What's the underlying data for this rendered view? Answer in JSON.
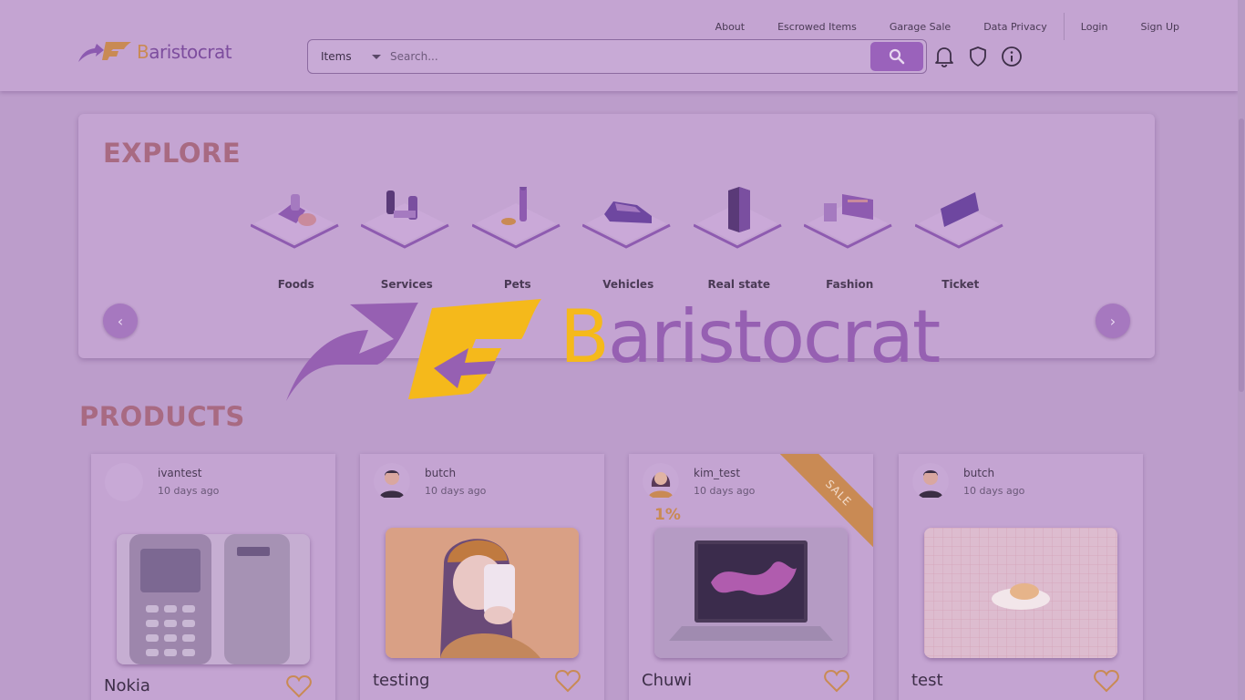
{
  "header": {
    "brand": "Baristocrat",
    "brand_first_letter": "B",
    "brand_rest": "aristocrat",
    "links": [
      "About",
      "Escrowed Items",
      "Garage Sale",
      "Data Privacy",
      "Login",
      "Sign Up"
    ],
    "search": {
      "category": "Items",
      "placeholder": "Search..."
    },
    "icons": [
      "bell-icon",
      "shield-icon",
      "info-icon"
    ]
  },
  "explore": {
    "title": "EXPLORE",
    "categories": [
      "Foods",
      "Services",
      "Pets",
      "Vehicles",
      "Real state",
      "Fashion",
      "Ticket"
    ],
    "prev_icon": "‹",
    "next_icon": "›"
  },
  "products": {
    "title": "PRODUCTS",
    "items": [
      {
        "seller": "ivantest",
        "posted": "10 days ago",
        "name": "Nokia",
        "image": "nokia-phone",
        "sale": false
      },
      {
        "seller": "butch",
        "posted": "10 days ago",
        "name": "testing",
        "image": "illustration-girl",
        "sale": false
      },
      {
        "seller": "kim_test",
        "posted": "10 days ago",
        "name": "Chuwi",
        "image": "laptop",
        "sale": true,
        "discount": "1%",
        "badge": "SALE"
      },
      {
        "seller": "butch",
        "posted": "10 days ago",
        "name": "test",
        "image": "grid-pad",
        "sale": false
      }
    ]
  },
  "overlay": {
    "brand_first_letter": "B",
    "brand_rest": "aristocrat"
  },
  "colors": {
    "accent": "#9a62bb",
    "orange": "#c98a54",
    "gold": "#f5b91b",
    "background": "#bc9dcb"
  }
}
